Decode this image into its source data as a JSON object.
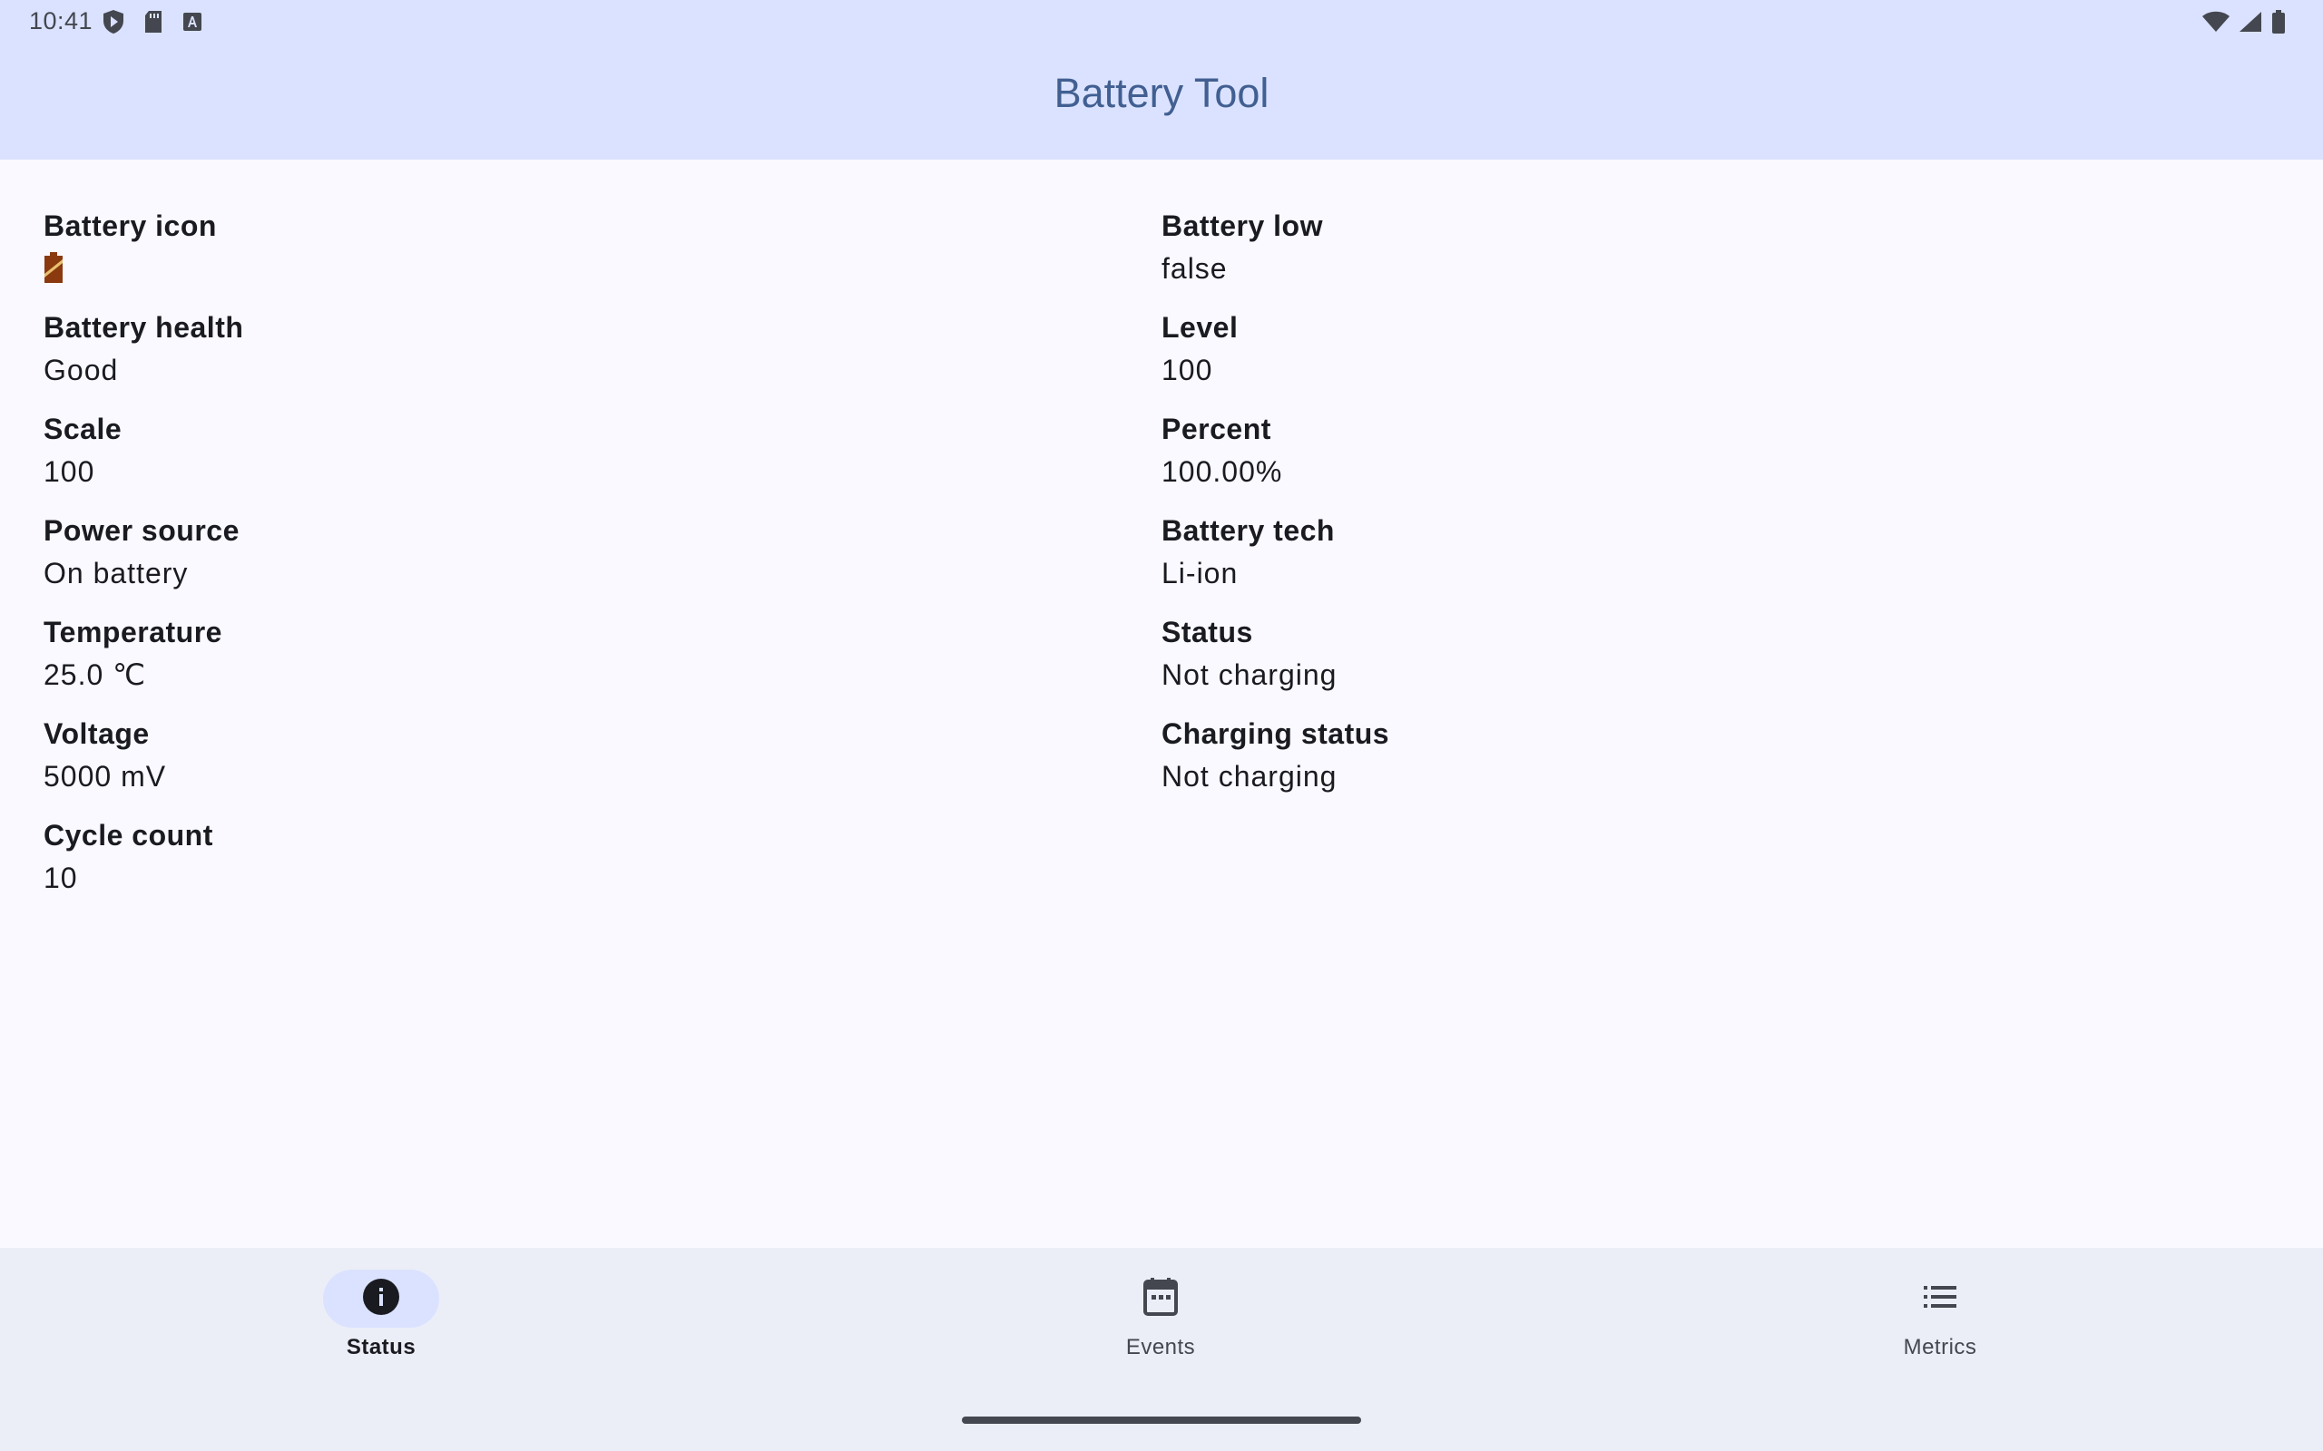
{
  "status_bar": {
    "time": "10:41",
    "left_icons": [
      "shield-play-icon",
      "sd-card-icon",
      "font-a-icon"
    ],
    "right_icons": [
      "wifi-icon",
      "cell-signal-icon",
      "battery-full-icon"
    ]
  },
  "app_bar": {
    "title": "Battery Tool"
  },
  "fields_left": [
    {
      "label": "Battery icon",
      "value": "",
      "icon": "battery-level-icon",
      "icon_color": "#8b3a0f"
    },
    {
      "label": "Battery health",
      "value": "Good"
    },
    {
      "label": "Scale",
      "value": "100"
    },
    {
      "label": "Power source",
      "value": "On battery"
    },
    {
      "label": "Temperature",
      "value": "25.0 ℃"
    },
    {
      "label": "Voltage",
      "value": "5000 mV"
    },
    {
      "label": "Cycle count",
      "value": "10"
    }
  ],
  "fields_right": [
    {
      "label": "Battery low",
      "value": "false"
    },
    {
      "label": "Level",
      "value": "100"
    },
    {
      "label": "Percent",
      "value": "100.00%"
    },
    {
      "label": "Battery tech",
      "value": "Li-ion"
    },
    {
      "label": "Status",
      "value": "Not charging"
    },
    {
      "label": "Charging status",
      "value": "Not charging"
    }
  ],
  "bottom_nav": {
    "items": [
      {
        "label": "Status",
        "icon": "info-icon",
        "selected": true
      },
      {
        "label": "Events",
        "icon": "calendar-icon",
        "selected": false
      },
      {
        "label": "Metrics",
        "icon": "list-icon",
        "selected": false
      }
    ]
  },
  "colors": {
    "app_bar_bg": "#dae2ff",
    "title": "#415f91",
    "surface": "#f9f9ff",
    "nav_bg": "#eceef7",
    "active_indicator": "#dae2ff"
  }
}
